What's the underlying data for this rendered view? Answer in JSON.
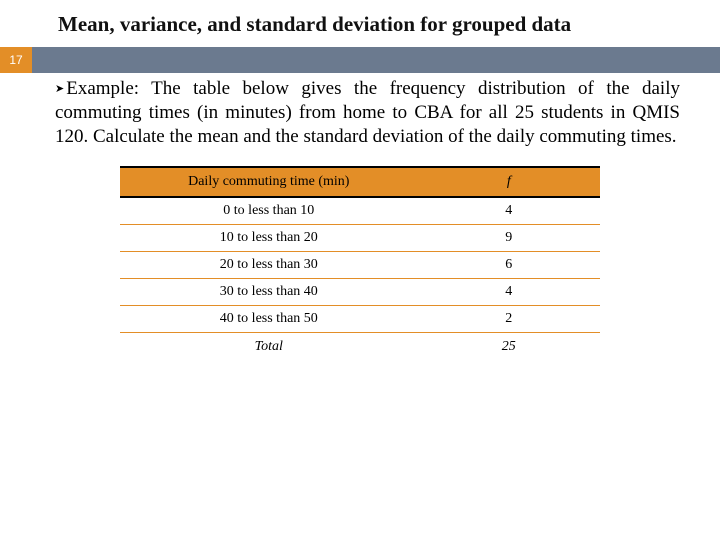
{
  "title": "Mean, variance, and standard deviation for grouped data",
  "pageNumber": "17",
  "example": {
    "label": "Example:",
    "text": " The table below gives the frequency distribution of the daily commuting times (in minutes) from home to CBA for all 25 students in QMIS 120. Calculate the mean and the standard deviation of the daily commuting times."
  },
  "table": {
    "headers": {
      "col1": "Daily commuting time (min)",
      "col2": "f"
    },
    "rows": [
      {
        "range": "0 to less than 10",
        "f": "4"
      },
      {
        "range": "10 to less than 20",
        "f": "9"
      },
      {
        "range": "20 to less than 30",
        "f": "6"
      },
      {
        "range": "30 to less than 40",
        "f": "4"
      },
      {
        "range": "40 to less than 50",
        "f": "2"
      }
    ],
    "total": {
      "label": "Total",
      "value": "25"
    }
  }
}
